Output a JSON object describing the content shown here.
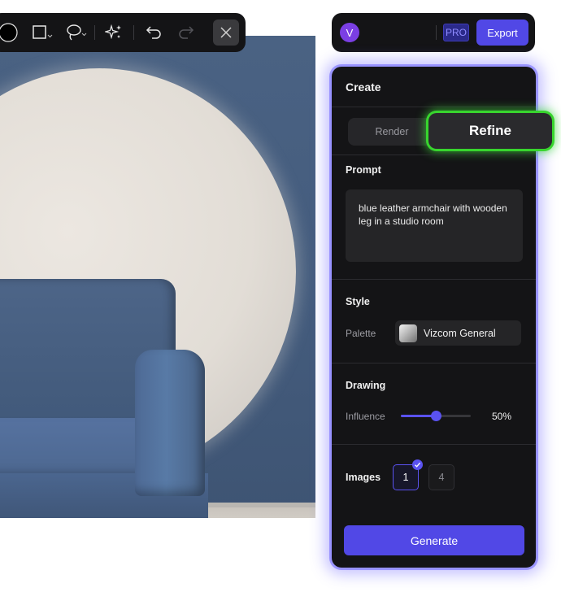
{
  "toolbar": {
    "tools": [
      "circle-shape-icon",
      "rectangle-tool-icon",
      "lasso-tool-icon",
      "sparkle-icon",
      "undo-icon",
      "redo-icon",
      "close-icon"
    ]
  },
  "topbar": {
    "avatar_initial": "V",
    "pro_label": "PRO",
    "export_label": "Export"
  },
  "panel": {
    "title": "Create",
    "tabs": [
      {
        "label": "Render",
        "active": false
      },
      {
        "label": "Refine",
        "active": true
      }
    ],
    "prompt": {
      "label": "Prompt",
      "value": "blue leather armchair with wooden leg in a studio room"
    },
    "style": {
      "label": "Style",
      "palette_label": "Palette",
      "palette_value": "Vizcom General"
    },
    "drawing": {
      "label": "Drawing",
      "influence_label": "Influence",
      "influence_value": "50%",
      "influence_fraction": 0.5
    },
    "images": {
      "label": "Images",
      "options": [
        "1",
        "4"
      ],
      "selected": "1"
    },
    "generate_label": "Generate"
  },
  "colors": {
    "accent": "#5148e6",
    "refine_highlight": "#38d52e",
    "panel_glow": "#6c64ff"
  }
}
